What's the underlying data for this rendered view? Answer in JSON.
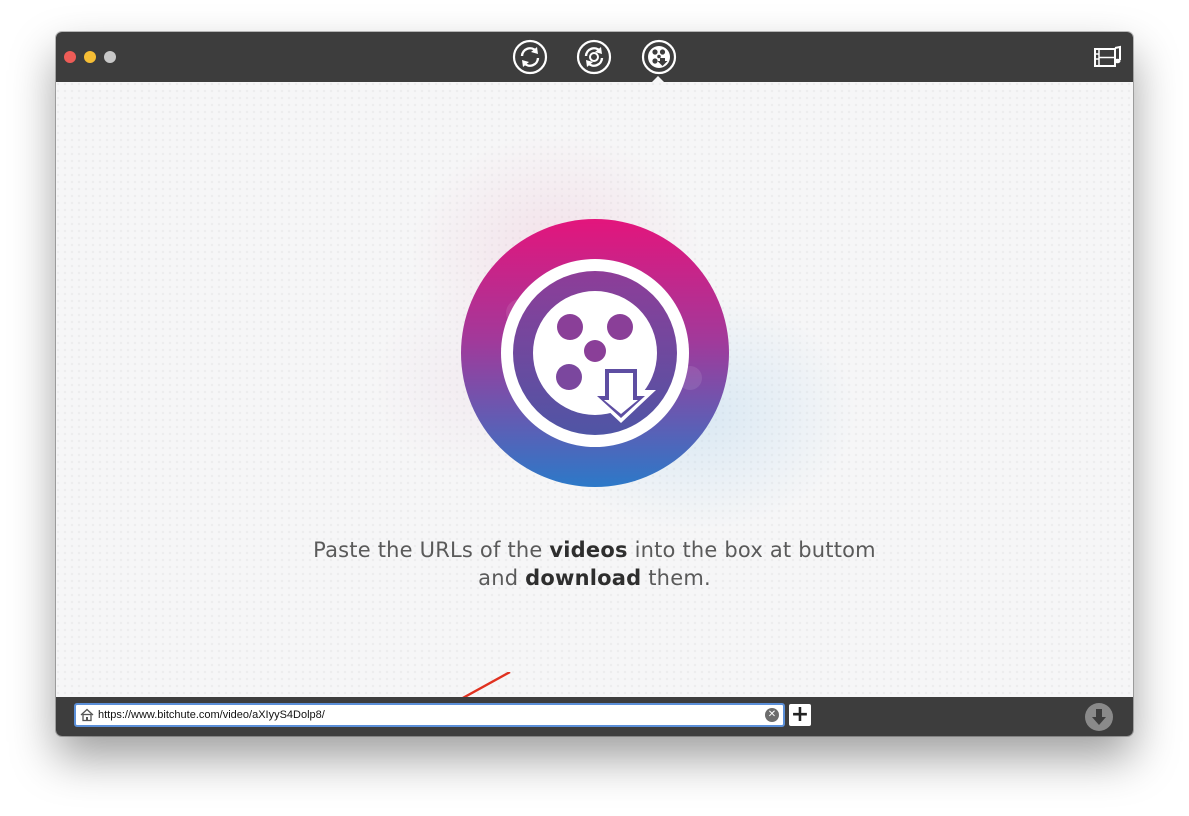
{
  "titlebar": {
    "traffic_lights": [
      "close",
      "minimize",
      "zoom"
    ],
    "tools": [
      {
        "name": "convert-icon",
        "active": false
      },
      {
        "name": "convert-dvd-icon",
        "active": false
      },
      {
        "name": "video-download-icon",
        "active": true
      }
    ],
    "media_icon": "media-browser-icon"
  },
  "main": {
    "tagline": {
      "line1_pre": "Paste the URLs of the ",
      "line1_bold": "videos",
      "line1_post": " into the box at buttom",
      "line2_pre": "and ",
      "line2_bold": "download",
      "line2_post": " them."
    },
    "logo_icon": "film-reel-download-icon"
  },
  "bottombar": {
    "url_value": "https://www.bitchute.com/video/aXIyyS4Dolp8/",
    "clear_icon": "clear-icon",
    "add_label": "+",
    "download_icon": "download-arrow-icon"
  },
  "colors": {
    "titlebar": "#3d3d3d",
    "accent_pink": "#e0197a",
    "accent_blue": "#2f77c9",
    "url_border": "#5b8fd8",
    "annotation_arrow": "#e03120"
  }
}
